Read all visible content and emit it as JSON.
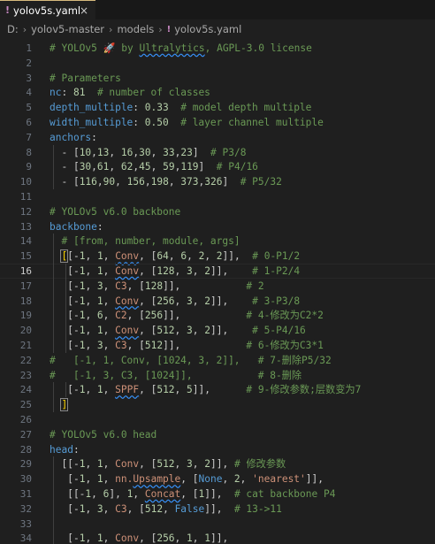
{
  "tab": {
    "label": "yolov5s.yaml",
    "close_glyph": "×",
    "icon": "yaml-icon"
  },
  "breadcrumb": {
    "items": [
      "D:",
      "yolov5-master",
      "models",
      "yolov5s.yaml"
    ]
  },
  "active_line": 16,
  "lines": [
    {
      "n": 1,
      "segs": [
        [
          "c",
          "# YOLOv5 "
        ],
        [
          "rocket",
          "🚀"
        ],
        [
          "c",
          " by "
        ],
        [
          "csq",
          "Ultralytics"
        ],
        [
          "c",
          ", AGPL-3.0 license"
        ]
      ]
    },
    {
      "n": 2,
      "segs": []
    },
    {
      "n": 3,
      "segs": [
        [
          "c",
          "# Parameters"
        ]
      ]
    },
    {
      "n": 4,
      "segs": [
        [
          "k",
          "nc"
        ],
        [
          "p",
          ": "
        ],
        [
          "n",
          "81"
        ],
        [
          "p",
          "  "
        ],
        [
          "c",
          "# number of classes"
        ]
      ]
    },
    {
      "n": 5,
      "segs": [
        [
          "k",
          "depth_multiple"
        ],
        [
          "p",
          ": "
        ],
        [
          "n",
          "0.33"
        ],
        [
          "p",
          "  "
        ],
        [
          "c",
          "# model depth multiple"
        ]
      ]
    },
    {
      "n": 6,
      "segs": [
        [
          "k",
          "width_multiple"
        ],
        [
          "p",
          ": "
        ],
        [
          "n",
          "0.50"
        ],
        [
          "p",
          "  "
        ],
        [
          "c",
          "# layer channel multiple"
        ]
      ]
    },
    {
      "n": 7,
      "segs": [
        [
          "k",
          "anchors"
        ],
        [
          "p",
          ":"
        ]
      ]
    },
    {
      "n": 8,
      "segs": [
        [
          "p",
          "  - ["
        ],
        [
          "n",
          "10"
        ],
        [
          "p",
          ","
        ],
        [
          "n",
          "13"
        ],
        [
          "p",
          ", "
        ],
        [
          "n",
          "16"
        ],
        [
          "p",
          ","
        ],
        [
          "n",
          "30"
        ],
        [
          "p",
          ", "
        ],
        [
          "n",
          "33"
        ],
        [
          "p",
          ","
        ],
        [
          "n",
          "23"
        ],
        [
          "p",
          "]  "
        ],
        [
          "c",
          "# P3/8"
        ]
      ]
    },
    {
      "n": 9,
      "segs": [
        [
          "p",
          "  - ["
        ],
        [
          "n",
          "30"
        ],
        [
          "p",
          ","
        ],
        [
          "n",
          "61"
        ],
        [
          "p",
          ", "
        ],
        [
          "n",
          "62"
        ],
        [
          "p",
          ","
        ],
        [
          "n",
          "45"
        ],
        [
          "p",
          ", "
        ],
        [
          "n",
          "59"
        ],
        [
          "p",
          ","
        ],
        [
          "n",
          "119"
        ],
        [
          "p",
          "]  "
        ],
        [
          "c",
          "# P4/16"
        ]
      ]
    },
    {
      "n": 10,
      "segs": [
        [
          "p",
          "  - ["
        ],
        [
          "n",
          "116"
        ],
        [
          "p",
          ","
        ],
        [
          "n",
          "90"
        ],
        [
          "p",
          ", "
        ],
        [
          "n",
          "156"
        ],
        [
          "p",
          ","
        ],
        [
          "n",
          "198"
        ],
        [
          "p",
          ", "
        ],
        [
          "n",
          "373"
        ],
        [
          "p",
          ","
        ],
        [
          "n",
          "326"
        ],
        [
          "p",
          "]  "
        ],
        [
          "c",
          "# P5/32"
        ]
      ]
    },
    {
      "n": 11,
      "segs": []
    },
    {
      "n": 12,
      "segs": [
        [
          "c",
          "# YOLOv5 v6.0 backbone"
        ]
      ]
    },
    {
      "n": 13,
      "segs": [
        [
          "k",
          "backbone"
        ],
        [
          "p",
          ":"
        ]
      ]
    },
    {
      "n": 14,
      "segs": [
        [
          "p",
          "  "
        ],
        [
          "c",
          "# [from, number, module, args]"
        ]
      ]
    },
    {
      "n": 15,
      "segs": [
        [
          "p",
          "  "
        ],
        [
          "bbox",
          "["
        ],
        [
          "p",
          "[-"
        ],
        [
          "n",
          "1"
        ],
        [
          "p",
          ", "
        ],
        [
          "n",
          "1"
        ],
        [
          "p",
          ", "
        ],
        [
          "ssq",
          "Conv"
        ],
        [
          "p",
          ", ["
        ],
        [
          "n",
          "64"
        ],
        [
          "p",
          ", "
        ],
        [
          "n",
          "6"
        ],
        [
          "p",
          ", "
        ],
        [
          "n",
          "2"
        ],
        [
          "p",
          ", "
        ],
        [
          "n",
          "2"
        ],
        [
          "p",
          "]],  "
        ],
        [
          "c",
          "# 0-P1/2"
        ]
      ]
    },
    {
      "n": 16,
      "segs": [
        [
          "p",
          "   [-"
        ],
        [
          "n",
          "1"
        ],
        [
          "p",
          ", "
        ],
        [
          "n",
          "1"
        ],
        [
          "p",
          ", "
        ],
        [
          "ssq",
          "Conv"
        ],
        [
          "p",
          ", ["
        ],
        [
          "n",
          "128"
        ],
        [
          "p",
          ", "
        ],
        [
          "n",
          "3"
        ],
        [
          "p",
          ", "
        ],
        [
          "n",
          "2"
        ],
        [
          "p",
          "]],    "
        ],
        [
          "c",
          "# 1-P2/4"
        ]
      ]
    },
    {
      "n": 17,
      "segs": [
        [
          "p",
          "   [-"
        ],
        [
          "n",
          "1"
        ],
        [
          "p",
          ", "
        ],
        [
          "n",
          "3"
        ],
        [
          "p",
          ", "
        ],
        [
          "s",
          "C3"
        ],
        [
          "p",
          ", ["
        ],
        [
          "n",
          "128"
        ],
        [
          "p",
          "]],"
        ],
        [
          "p",
          "           "
        ],
        [
          "c",
          "# 2"
        ]
      ]
    },
    {
      "n": 18,
      "segs": [
        [
          "p",
          "   [-"
        ],
        [
          "n",
          "1"
        ],
        [
          "p",
          ", "
        ],
        [
          "n",
          "1"
        ],
        [
          "p",
          ", "
        ],
        [
          "ssq",
          "Conv"
        ],
        [
          "p",
          ", ["
        ],
        [
          "n",
          "256"
        ],
        [
          "p",
          ", "
        ],
        [
          "n",
          "3"
        ],
        [
          "p",
          ", "
        ],
        [
          "n",
          "2"
        ],
        [
          "p",
          "]],    "
        ],
        [
          "c",
          "# 3-P3/8"
        ]
      ]
    },
    {
      "n": 19,
      "segs": [
        [
          "p",
          "   [-"
        ],
        [
          "n",
          "1"
        ],
        [
          "p",
          ", "
        ],
        [
          "n",
          "6"
        ],
        [
          "p",
          ", "
        ],
        [
          "s",
          "C2"
        ],
        [
          "p",
          ", ["
        ],
        [
          "n",
          "256"
        ],
        [
          "p",
          "]],"
        ],
        [
          "p",
          "           "
        ],
        [
          "c",
          "# 4-修改为C2*2"
        ]
      ]
    },
    {
      "n": 20,
      "segs": [
        [
          "p",
          "   [-"
        ],
        [
          "n",
          "1"
        ],
        [
          "p",
          ", "
        ],
        [
          "n",
          "1"
        ],
        [
          "p",
          ", "
        ],
        [
          "ssq",
          "Conv"
        ],
        [
          "p",
          ", ["
        ],
        [
          "n",
          "512"
        ],
        [
          "p",
          ", "
        ],
        [
          "n",
          "3"
        ],
        [
          "p",
          ", "
        ],
        [
          "n",
          "2"
        ],
        [
          "p",
          "]],    "
        ],
        [
          "c",
          "# 5-P4/16"
        ]
      ]
    },
    {
      "n": 21,
      "segs": [
        [
          "p",
          "   [-"
        ],
        [
          "n",
          "1"
        ],
        [
          "p",
          ", "
        ],
        [
          "n",
          "3"
        ],
        [
          "p",
          ", "
        ],
        [
          "s",
          "C3"
        ],
        [
          "p",
          ", ["
        ],
        [
          "n",
          "512"
        ],
        [
          "p",
          "]],"
        ],
        [
          "p",
          "           "
        ],
        [
          "c",
          "# 6-修改为C3*1"
        ]
      ]
    },
    {
      "n": 22,
      "segs": [
        [
          "c",
          "#   [-1, 1, Conv, [1024, 3, 2]],   # 7-删除P5/32"
        ]
      ]
    },
    {
      "n": 23,
      "segs": [
        [
          "c",
          "#   [-1, 3, C3, [1024]],           # 8-删除"
        ]
      ]
    },
    {
      "n": 24,
      "segs": [
        [
          "p",
          "   [-"
        ],
        [
          "n",
          "1"
        ],
        [
          "p",
          ", "
        ],
        [
          "n",
          "1"
        ],
        [
          "p",
          ", "
        ],
        [
          "ssq",
          "SPPF"
        ],
        [
          "p",
          ", ["
        ],
        [
          "n",
          "512"
        ],
        [
          "p",
          ", "
        ],
        [
          "n",
          "5"
        ],
        [
          "p",
          "]],      "
        ],
        [
          "c",
          "# 9-修改参数;层数变为7"
        ]
      ]
    },
    {
      "n": 25,
      "segs": [
        [
          "p",
          "  "
        ],
        [
          "bbox",
          "]"
        ]
      ]
    },
    {
      "n": 26,
      "segs": []
    },
    {
      "n": 27,
      "segs": [
        [
          "c",
          "# YOLOv5 v6.0 head"
        ]
      ]
    },
    {
      "n": 28,
      "segs": [
        [
          "k",
          "head"
        ],
        [
          "p",
          ":"
        ]
      ]
    },
    {
      "n": 29,
      "segs": [
        [
          "p",
          "  [[-"
        ],
        [
          "n",
          "1"
        ],
        [
          "p",
          ", "
        ],
        [
          "n",
          "1"
        ],
        [
          "p",
          ", "
        ],
        [
          "s",
          "Conv"
        ],
        [
          "p",
          ", ["
        ],
        [
          "n",
          "512"
        ],
        [
          "p",
          ", "
        ],
        [
          "n",
          "3"
        ],
        [
          "p",
          ", "
        ],
        [
          "n",
          "2"
        ],
        [
          "p",
          "]], "
        ],
        [
          "c",
          "# 修改参数"
        ]
      ]
    },
    {
      "n": 30,
      "segs": [
        [
          "p",
          "   [-"
        ],
        [
          "n",
          "1"
        ],
        [
          "p",
          ", "
        ],
        [
          "n",
          "1"
        ],
        [
          "p",
          ", "
        ],
        [
          "s",
          "nn."
        ],
        [
          "ssq",
          "Upsample"
        ],
        [
          "p",
          ", ["
        ],
        [
          "k",
          "None"
        ],
        [
          "p",
          ", "
        ],
        [
          "n",
          "2"
        ],
        [
          "p",
          ", "
        ],
        [
          "s",
          "'nearest'"
        ],
        [
          "p",
          "]],"
        ]
      ]
    },
    {
      "n": 31,
      "segs": [
        [
          "p",
          "   [[-"
        ],
        [
          "n",
          "1"
        ],
        [
          "p",
          ", "
        ],
        [
          "n",
          "6"
        ],
        [
          "p",
          "], "
        ],
        [
          "n",
          "1"
        ],
        [
          "p",
          ", "
        ],
        [
          "ssq",
          "Concat"
        ],
        [
          "p",
          ", ["
        ],
        [
          "n",
          "1"
        ],
        [
          "p",
          "]],  "
        ],
        [
          "c",
          "# cat backbone P4"
        ]
      ]
    },
    {
      "n": 32,
      "segs": [
        [
          "p",
          "   [-"
        ],
        [
          "n",
          "1"
        ],
        [
          "p",
          ", "
        ],
        [
          "n",
          "3"
        ],
        [
          "p",
          ", "
        ],
        [
          "s",
          "C3"
        ],
        [
          "p",
          ", ["
        ],
        [
          "n",
          "512"
        ],
        [
          "p",
          ", "
        ],
        [
          "k",
          "False"
        ],
        [
          "p",
          "]],  "
        ],
        [
          "c",
          "# 13->11"
        ]
      ]
    },
    {
      "n": 33,
      "segs": []
    },
    {
      "n": 34,
      "segs": [
        [
          "p",
          "   [-"
        ],
        [
          "n",
          "1"
        ],
        [
          "p",
          ", "
        ],
        [
          "n",
          "1"
        ],
        [
          "p",
          ", "
        ],
        [
          "s",
          "Conv"
        ],
        [
          "p",
          ", ["
        ],
        [
          "n",
          "256"
        ],
        [
          "p",
          ", "
        ],
        [
          "n",
          "1"
        ],
        [
          "p",
          ", "
        ],
        [
          "n",
          "1"
        ],
        [
          "p",
          "]],"
        ]
      ]
    }
  ]
}
